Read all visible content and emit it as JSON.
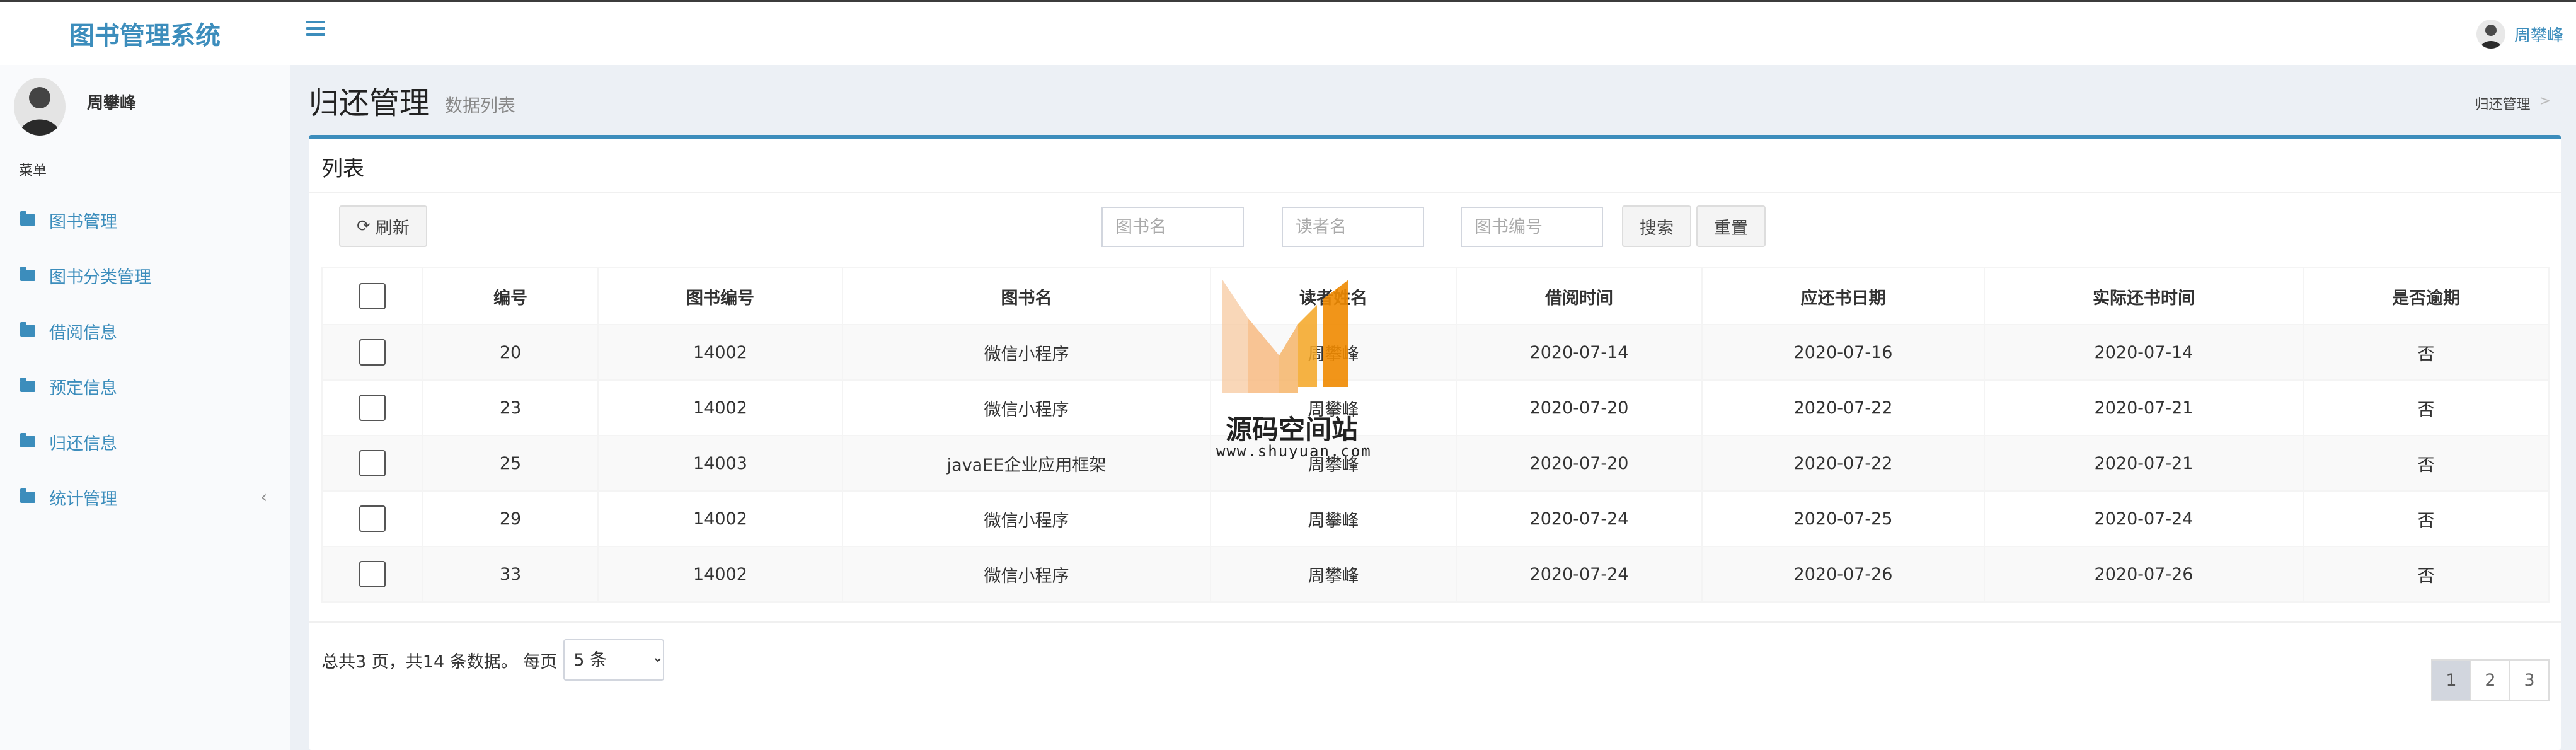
{
  "app": {
    "title": "图书管理系统"
  },
  "header": {
    "user_name": "周攀峰"
  },
  "sidebar": {
    "user_name": "周攀峰",
    "menu_header": "菜单",
    "items": [
      {
        "label": "图书管理"
      },
      {
        "label": "图书分类管理"
      },
      {
        "label": "借阅信息"
      },
      {
        "label": "预定信息"
      },
      {
        "label": "归还信息"
      },
      {
        "label": "统计管理",
        "chevron": "‹"
      }
    ]
  },
  "page": {
    "title": "归还管理",
    "subtitle": "数据列表",
    "breadcrumb": "归还管理",
    "breadcrumb_sep": ">"
  },
  "box": {
    "title": "列表",
    "refresh_label": "刷新",
    "search_label": "搜索",
    "reset_label": "重置",
    "filters": {
      "book_name_placeholder": "图书名",
      "reader_name_placeholder": "读者名",
      "book_code_placeholder": "图书编号"
    }
  },
  "table": {
    "headers": [
      "编号",
      "图书编号",
      "图书名",
      "读者姓名",
      "借阅时间",
      "应还书日期",
      "实际还书时间",
      "是否逾期"
    ],
    "rows": [
      {
        "id": "20",
        "book_code": "14002",
        "book_name": "微信小程序",
        "reader": "周攀峰",
        "borrow_date": "2020-07-14",
        "due_date": "2020-07-16",
        "return_date": "2020-07-14",
        "overdue": "否"
      },
      {
        "id": "23",
        "book_code": "14002",
        "book_name": "微信小程序",
        "reader": "周攀峰",
        "borrow_date": "2020-07-20",
        "due_date": "2020-07-22",
        "return_date": "2020-07-21",
        "overdue": "否"
      },
      {
        "id": "25",
        "book_code": "14003",
        "book_name": "javaEE企业应用框架",
        "reader": "周攀峰",
        "borrow_date": "2020-07-20",
        "due_date": "2020-07-22",
        "return_date": "2020-07-21",
        "overdue": "否"
      },
      {
        "id": "29",
        "book_code": "14002",
        "book_name": "微信小程序",
        "reader": "周攀峰",
        "borrow_date": "2020-07-24",
        "due_date": "2020-07-25",
        "return_date": "2020-07-24",
        "overdue": "否"
      },
      {
        "id": "33",
        "book_code": "14002",
        "book_name": "微信小程序",
        "reader": "周攀峰",
        "borrow_date": "2020-07-24",
        "due_date": "2020-07-26",
        "return_date": "2020-07-26",
        "overdue": "否"
      }
    ]
  },
  "pagination": {
    "summary": "总共3 页，共14 条数据。 每页",
    "page_size": "5 条",
    "pages": [
      "1",
      "2",
      "3"
    ],
    "current_page": "1"
  },
  "watermark": {
    "text": "源码空间站",
    "url": "www.shuyuan.com"
  },
  "colors": {
    "brand": "#3c8dbc",
    "watermark_orange": "#f5a623"
  },
  "icons": {
    "menu": "menu-icon",
    "refresh": "refresh-icon",
    "folder": "folder-icon",
    "chevron": "chevron-left-icon"
  }
}
